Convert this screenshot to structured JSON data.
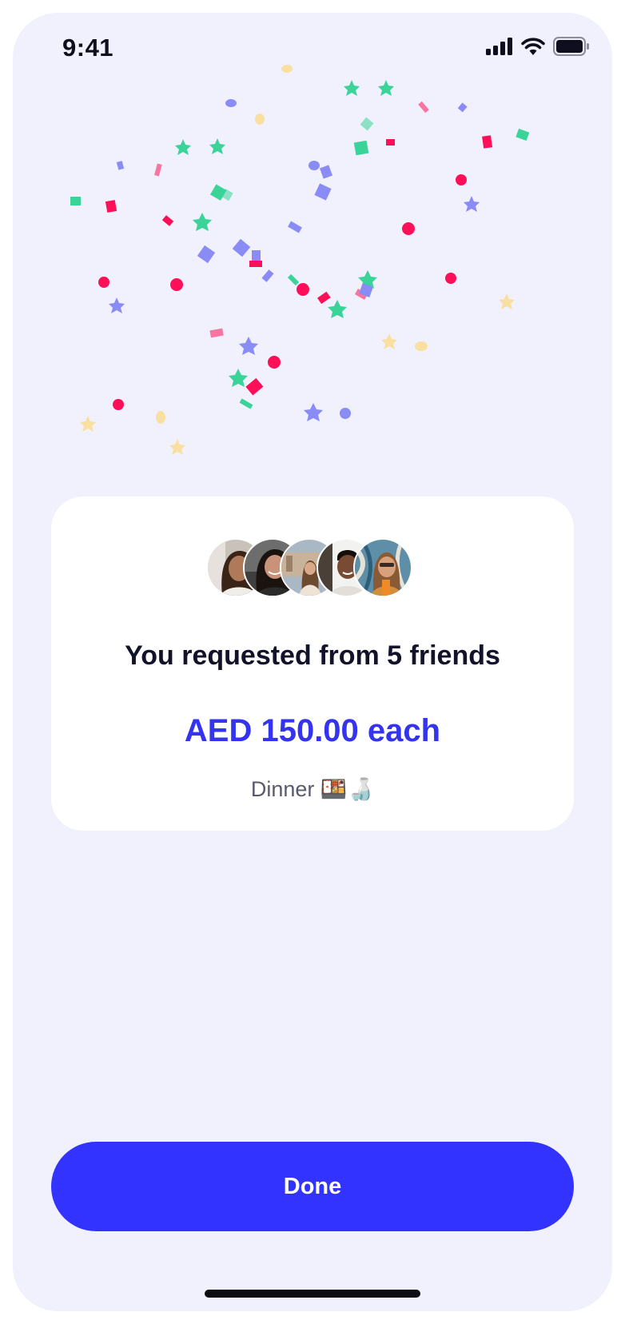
{
  "status_bar": {
    "time": "9:41"
  },
  "summary": {
    "title": "You requested from 5 friends",
    "amount": "AED 150.00 each",
    "note": "Dinner 🍱🍶",
    "friend_count": 5
  },
  "actions": {
    "done_label": "Done"
  },
  "colors": {
    "accent": "#3333ff",
    "background": "#f1f1fd",
    "confetti": [
      "#ff0f57",
      "#3ad398",
      "#8a8cf5",
      "#f9dfa0"
    ]
  },
  "icons": [
    "signal-icon",
    "wifi-icon",
    "battery-icon"
  ]
}
